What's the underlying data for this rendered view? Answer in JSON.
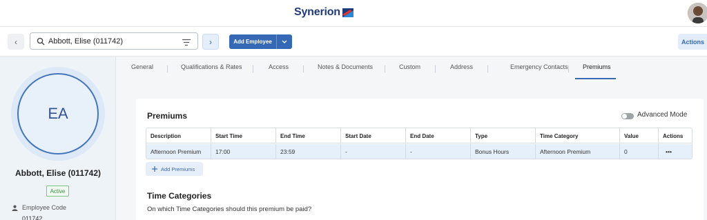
{
  "brand": {
    "name": "Synerion"
  },
  "search": {
    "value": "Abbott, Elise (011742)"
  },
  "toolbar": {
    "add_employee": "Add Employee",
    "actions": "Actions"
  },
  "profile": {
    "initials": "EA",
    "name": "Abbott, Elise (011742)",
    "status": "Active",
    "code_label": "Employee Code",
    "code_value": "011742"
  },
  "tabs": [
    "General",
    "Qualifications & Rates",
    "Access",
    "Notes & Documents",
    "Custom",
    "Address",
    "Emergency Contacts",
    "Premiums"
  ],
  "active_tab": "Premiums",
  "premiums": {
    "title": "Premiums",
    "advanced_mode_label": "Advanced Mode",
    "advanced_mode_on": false,
    "columns": [
      "Description",
      "Start Time",
      "End Time",
      "Start Date",
      "End Date",
      "Type",
      "Time Category",
      "Value",
      "Actions"
    ],
    "rows": [
      [
        "Afternoon Premium",
        "17:00",
        "23:59",
        "-",
        "-",
        "Bonus Hours",
        "Afternoon Premium",
        "0",
        "•••"
      ]
    ],
    "add_label": "Add Premiums"
  },
  "time_categories": {
    "title": "Time Categories",
    "description": "On which Time Categories should this premium be paid?"
  },
  "colors": {
    "accent": "#3568b5",
    "brand_dark": "#1d3b78",
    "status_green": "#3f8a47",
    "row_highlight": "#e6f0fb"
  }
}
